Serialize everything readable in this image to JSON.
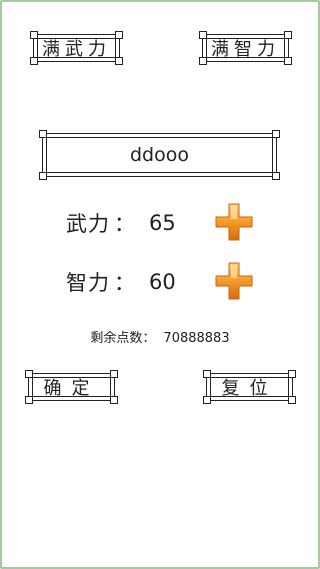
{
  "top_buttons": {
    "max_force": "满武力",
    "max_intellect": "满智力"
  },
  "name_box": {
    "value": "ddooo"
  },
  "stats": {
    "force": {
      "label": "武力",
      "colon": "：",
      "value": "65",
      "add_icon": "plus-icon"
    },
    "intellect": {
      "label": "智力",
      "colon": "：",
      "value": "60",
      "add_icon": "plus-icon"
    }
  },
  "remaining": {
    "label": "剩余点数：",
    "value": "70888883"
  },
  "bottom_buttons": {
    "confirm": "确定",
    "reset": "复位"
  },
  "colors": {
    "accent": "#f08a1c",
    "frame": "#a8c8a0"
  }
}
